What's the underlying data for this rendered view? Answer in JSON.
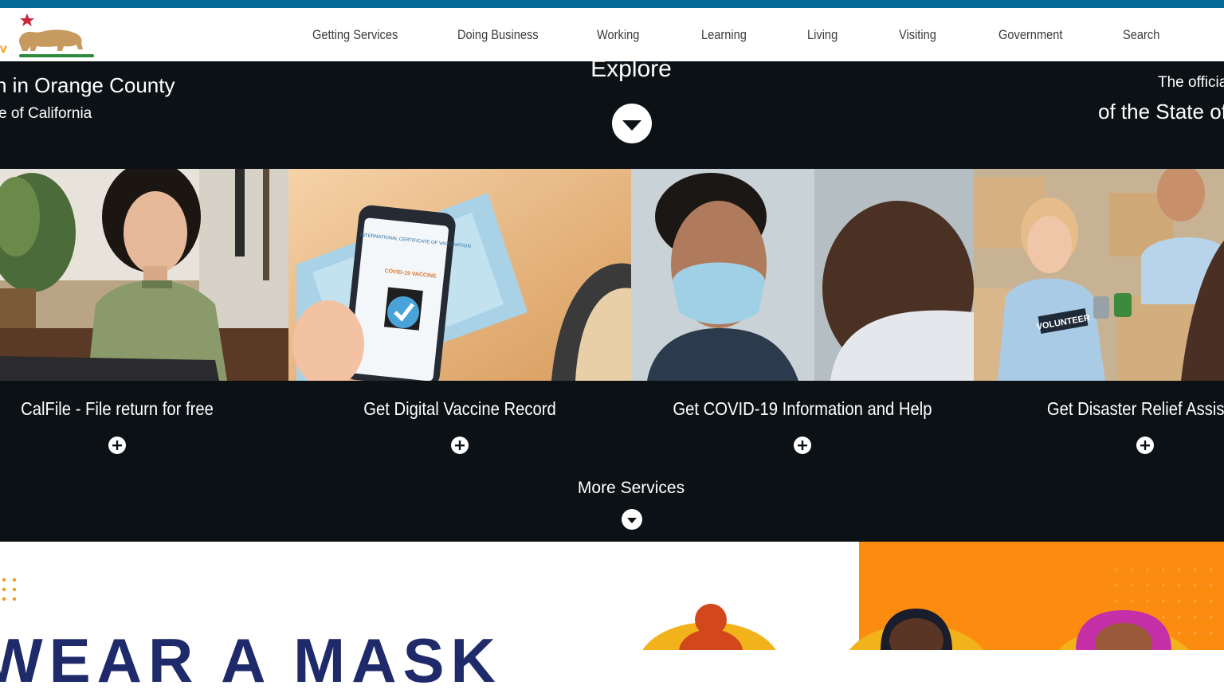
{
  "colors": {
    "top_strip": "#046b99",
    "hero_bg": "#0c1115",
    "campaign_orange": "#fc8c10",
    "campaign_navy": "#1f2a6b",
    "logo_star": "#c8283b",
    "logo_green": "#2e8b3d"
  },
  "header": {
    "logo_icon": "ca-gov-bear-logo-icon",
    "nav": [
      "Getting Services",
      "Doing Business",
      "Working",
      "Learning",
      "Living",
      "Visiting",
      "Government",
      "Search"
    ]
  },
  "hero": {
    "left_tagline": "h in Orange County",
    "left_subtagline": "e of California",
    "explore_label": "Explore",
    "explore_icon": "caret-down-circle-icon",
    "right_tagline": "The officia",
    "right_subtagline": "of the State of (",
    "cards": [
      {
        "title": "CalFile - File return for free",
        "image": "woman-at-laptop-photo"
      },
      {
        "title": "Get Digital Vaccine Record",
        "image": "phone-vaccine-record-photo"
      },
      {
        "title": "Get COVID-19 Information and Help",
        "image": "masked-healthcare-worker-photo"
      },
      {
        "title": "Get Disaster Relief Assistar",
        "image": "volunteers-food-drive-photo"
      }
    ],
    "plus_icon": "plus-circle-icon",
    "more_services_label": "More Services",
    "more_icon": "caret-down-circle-icon"
  },
  "banner": {
    "headline": "WEAR A MASK"
  },
  "photo_text": {
    "phone_header": "INTERNATIONAL CERTIFICATE OF VACCINATION",
    "phone_label": "COVID-19 VACCINE",
    "volunteer_shirt": "VOLUNTEER"
  }
}
